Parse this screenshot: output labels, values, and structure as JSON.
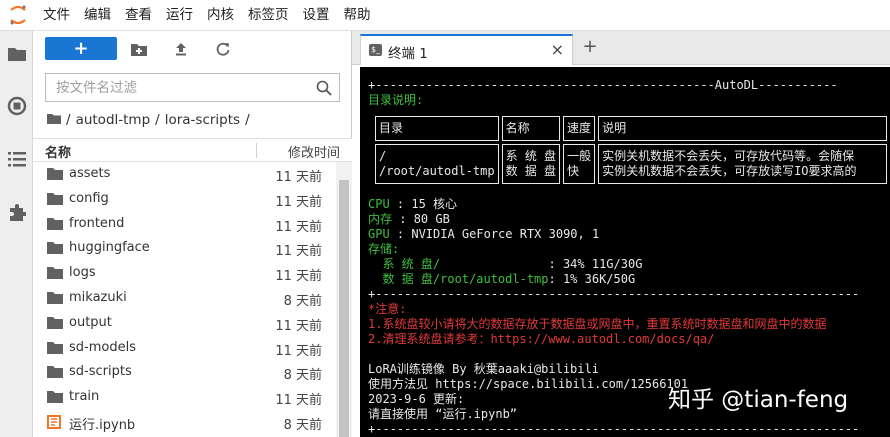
{
  "menu": [
    "文件",
    "编辑",
    "查看",
    "运行",
    "内核",
    "标签页",
    "设置",
    "帮助"
  ],
  "filebrowser": {
    "new_label": "+",
    "filter_placeholder": "按文件名过滤",
    "breadcrumb": [
      "/",
      "autodl-tmp",
      "/",
      "lora-scripts",
      "/"
    ],
    "col_name": "名称",
    "col_modified": "修改时间",
    "files": [
      {
        "name": "assets",
        "modified": "11 天前",
        "type": "folder"
      },
      {
        "name": "config",
        "modified": "11 天前",
        "type": "folder"
      },
      {
        "name": "frontend",
        "modified": "11 天前",
        "type": "folder"
      },
      {
        "name": "huggingface",
        "modified": "11 天前",
        "type": "folder"
      },
      {
        "name": "logs",
        "modified": "11 天前",
        "type": "folder"
      },
      {
        "name": "mikazuki",
        "modified": "8 天前",
        "type": "folder"
      },
      {
        "name": "output",
        "modified": "11 天前",
        "type": "folder"
      },
      {
        "name": "sd-models",
        "modified": "11 天前",
        "type": "folder"
      },
      {
        "name": "sd-scripts",
        "modified": "8 天前",
        "type": "folder"
      },
      {
        "name": "train",
        "modified": "11 天前",
        "type": "folder"
      },
      {
        "name": "运行.ipynb",
        "modified": "8 天前",
        "type": "notebook"
      }
    ]
  },
  "terminal_tab": {
    "label": "终端 1",
    "close": "×",
    "add": "+"
  },
  "terminal": {
    "banner": "+-----------------------------------------------AutoDL-----------",
    "dir_heading": "目录说明:",
    "table": {
      "header": [
        "目录",
        "名称",
        "速度",
        "说明"
      ],
      "row_col1": [
        "/",
        "/root/autodl-tmp"
      ],
      "row_col2": [
        "系 统 盘",
        "数 据 盘"
      ],
      "row_col3": [
        "一般",
        "快"
      ],
      "row_col4": [
        "实例关机数据不会丢失，可存放代码等。会随保",
        "实例关机数据不会丢失，可存放读写IO要求高的"
      ]
    },
    "cpu_label": "CPU",
    "cpu_value": " : 15 核心",
    "mem_label": "内存",
    "mem_value": " : 80 GB",
    "gpu_label": "GPU",
    "gpu_value": " : NVIDIA GeForce RTX 3090, 1",
    "storage_label": "存储:",
    "sys_disk_label": "  系 统 盘/              ",
    "sys_disk_value": " : 34% 11G/30G",
    "data_disk_label": "  数 据 盘/root/autodl-tmp",
    "data_disk_value": ": 1% 36K/50G",
    "separator": "+-------------------------------------------------------------------",
    "note_heading": "*注意:",
    "note1": "1.系统盘较小请将大的数据存放于数据盘或网盘中，重置系统时数据盘和网盘中的数据",
    "note2": "2.清理系统盘请参考：https://www.autodl.com/docs/qa/",
    "lora_line": "LoRA训练镜像 By 秋葉aaaki@bilibili",
    "usage_line": "使用方法见 https://space.bilibili.com/12566101",
    "update_line": "2023-9-6 更新:",
    "run_line": "请直接使用 “运行.ipynb”",
    "end_sep": "+-------------------------------------------------------------------"
  },
  "watermark": "知乎 @tian-feng",
  "colors": {
    "accent": "#1976d2",
    "terminal_green": "#3fbf3f",
    "terminal_red": "#e23a3a",
    "folder": "#616161"
  }
}
